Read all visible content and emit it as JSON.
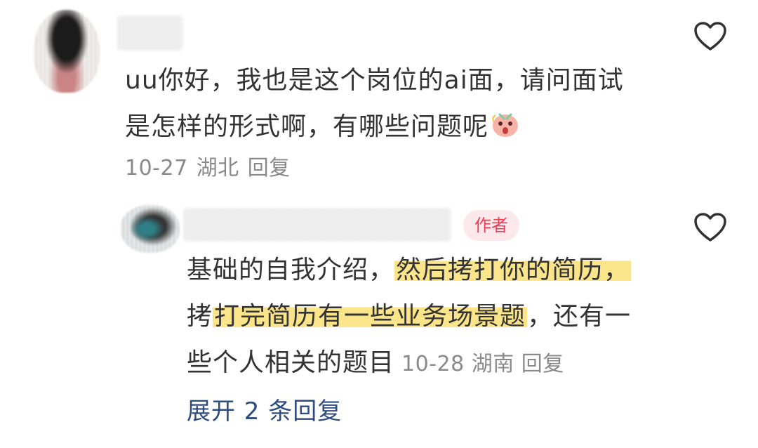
{
  "comment1": {
    "text_line1": "uu你好，我也是这个岗位的ai面，请问面试",
    "text_line2": "是怎样的形式啊，有哪些问题呢",
    "emoji": "shocked-face-emoji",
    "date": "10-27",
    "location": "湖北",
    "reply_label": "回复"
  },
  "comment2": {
    "badge": "作者",
    "seg1": "基础的自我介绍，",
    "hl1": "然后拷打你的简历，",
    "seg2": "拷",
    "hl2": "打完简历有一些业务场景题",
    "seg3": "，还有一",
    "seg4": "些个人相关的题目",
    "date": "10-28",
    "location": "湖南",
    "reply_label": "回复"
  },
  "expand_replies": "展开 2 条回复",
  "colors": {
    "highlight": "#fbe58a",
    "badge_bg": "#fde9ec",
    "badge_text": "#ef3b55",
    "link": "#2e4c7d",
    "meta": "#8a8a8a"
  },
  "icons": [
    "heart-outline-icon",
    "heart-outline-icon"
  ]
}
